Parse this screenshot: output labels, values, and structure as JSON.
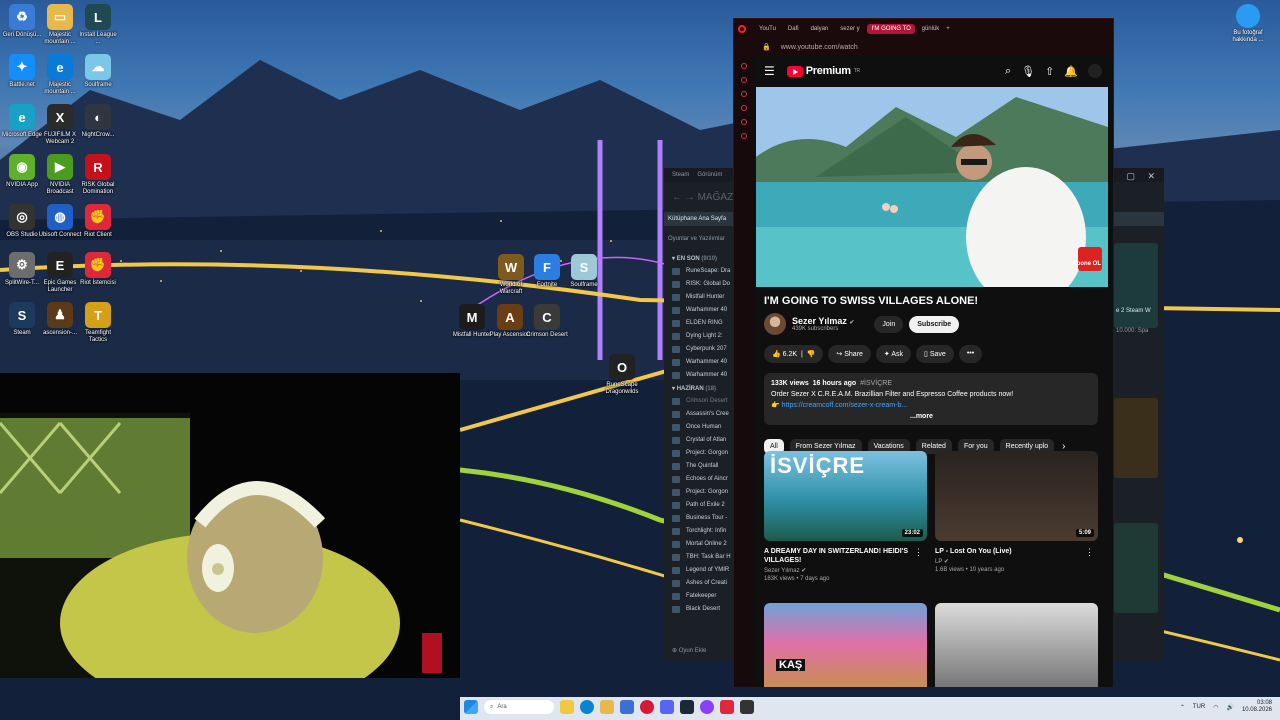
{
  "desktop": {
    "icons": [
      {
        "label": "Geri Dönüşü...",
        "color": "#3a7bd5",
        "glyph": "♻"
      },
      {
        "label": "Majestic mountain ...",
        "color": "#e8b84a",
        "glyph": "▭"
      },
      {
        "label": "Install League ...",
        "color": "#1f4a52",
        "glyph": "L"
      },
      {
        "label": "Battle.net",
        "color": "#148eff",
        "glyph": "✦"
      },
      {
        "label": "Majestic mountain ...",
        "color": "#0a7ad9",
        "glyph": "e"
      },
      {
        "label": "Soulframe",
        "color": "#7bc7e8",
        "glyph": "☁"
      },
      {
        "label": "Microsoft Edge",
        "color": "#19a0c7",
        "glyph": "e"
      },
      {
        "label": "FUJIFILM X Webcam 2",
        "color": "#2b2b2b",
        "glyph": "X"
      },
      {
        "label": "NightCrow...",
        "color": "#2f3640",
        "glyph": "◐"
      },
      {
        "label": "NVIDIA App",
        "color": "#5fb12b",
        "glyph": "◉"
      },
      {
        "label": "NVIDIA Broadcast",
        "color": "#4c9c1f",
        "glyph": "▶"
      },
      {
        "label": "RISK Global Domination",
        "color": "#c4121a",
        "glyph": "R"
      },
      {
        "label": "OBS Studio",
        "color": "#333",
        "glyph": "◎"
      },
      {
        "label": "Ubisoft Connect",
        "color": "#1f5fc7",
        "glyph": "◍"
      },
      {
        "label": "Riot Client",
        "color": "#e0283b",
        "glyph": "✊"
      },
      {
        "label": "SplitWire-T...",
        "color": "#6d6d6d",
        "glyph": "⚙"
      },
      {
        "label": "Epic Games Launcher",
        "color": "#222",
        "glyph": "E"
      },
      {
        "label": "Riot İstemcisi",
        "color": "#e0283b",
        "glyph": "✊"
      },
      {
        "label": "Steam",
        "color": "#1b3a5c",
        "glyph": "S"
      },
      {
        "label": "ascension-...",
        "color": "#5b3a1a",
        "glyph": "♟"
      },
      {
        "label": "Teamfight Tactics",
        "color": "#d4a017",
        "glyph": "T"
      },
      {
        "label": "World of Warcraft",
        "color": "#7d5a1e",
        "glyph": "W"
      },
      {
        "label": "Fortnite",
        "color": "#2a7de1",
        "glyph": "F"
      },
      {
        "label": "Soulframe",
        "color": "#9ec7d8",
        "glyph": "S"
      },
      {
        "label": "Mistfall Hunter",
        "color": "#1c1c1c",
        "glyph": "M"
      },
      {
        "label": "Play Ascension",
        "color": "#6b3d15",
        "glyph": "A"
      },
      {
        "label": "Crimson Desert",
        "color": "#3a3a3a",
        "glyph": "C"
      },
      {
        "label": "RuneScape Dragonwilds",
        "color": "#222",
        "glyph": "O"
      }
    ],
    "notify": {
      "label": "Bu fotoğraf hakkında ..."
    }
  },
  "steam": {
    "title_items": [
      "Steam",
      "Görünüm"
    ],
    "store_label": "MAĞAZA",
    "library_home": "Kütüphane Ana Sayfa",
    "filter": "Oyunlar ve Yazılımlar",
    "section_recent": "EN SON",
    "section_recent_count": "(9/10)",
    "recent": [
      "RuneScape: Dra",
      "RISK: Global Do",
      "Mistfall Hunter",
      "Warhammer 40",
      "ELDEN RING",
      "Dying Light 2:",
      "Cyberpunk 207",
      "Warhammer 40",
      "Warhammer 40"
    ],
    "section_june": "HAZİRAN",
    "section_june_count": "(18)",
    "june": [
      "Crimson Desert",
      "Assassin's Cree",
      "Once Human",
      "Crystal of Atlan",
      "Project: Gorgon",
      "The Quinfall",
      "Echoes of Aincr",
      "Project: Gorgon",
      "Path of Exile 2",
      "Business Tour -",
      "Torchlight: Infin",
      "Mortal Online 2",
      "TBH: Task Bar H",
      "Legend of YMIR",
      "Ashes of Creati",
      "Fatekeeper",
      "Black Desert"
    ],
    "add_game": "Oyun Ekle",
    "shelf_labels": [
      "e 2 Steam W",
      "10.000: Spa"
    ]
  },
  "browser": {
    "tabs": [
      {
        "label": "YouTu",
        "active": false
      },
      {
        "label": "Dafi",
        "active": false
      },
      {
        "label": "dalyan",
        "active": false
      },
      {
        "label": "sezer y",
        "active": false
      },
      {
        "label": "I'M GOING TO",
        "active": true
      },
      {
        "label": "günlük",
        "active": false
      }
    ],
    "url": "www.youtube.com/watch"
  },
  "youtube": {
    "logo_text": "Premium",
    "region": "TR",
    "video": {
      "title": "I'M GOING TO SWISS VILLAGES ALONE!",
      "watermark": "Abone OL"
    },
    "channel": {
      "name": "Sezer Yılmaz",
      "subs": "439K subscribers",
      "join": "Join",
      "subscribe": "Subscribe"
    },
    "actions": {
      "likes": "6.2K",
      "share": "Share",
      "ask": "Ask",
      "save": "Save"
    },
    "description": {
      "views": "133K views",
      "age": "16 hours ago",
      "tag": "#İSVİÇRE",
      "line1": "Order Sezer X C.R.E.A.M. Brazillian Filter and Espresso Coffee products now!",
      "link": "https://creamcoff.com/sezer-x-cream-b...",
      "more": "...more"
    },
    "chips": [
      "All",
      "From Sezer Yılmaz",
      "Vacations",
      "Related",
      "For you",
      "Recently uplo"
    ],
    "recommendations": [
      {
        "title": "A DREAMY DAY IN SWITZERLAND! HEIDI'S VILLAGES!",
        "channel": "Sezer Yılmaz",
        "meta": "183K views • 7 days ago",
        "duration": "23:02",
        "overlay": "İSVİÇRE"
      },
      {
        "title": "LP - Lost On You (Live)",
        "channel": "LP",
        "meta": "1.6B views • 10 years ago",
        "duration": "5:09",
        "overlay": ""
      },
      {
        "title": "",
        "channel": "",
        "meta": "",
        "duration": "",
        "overlay": "KAŞ"
      },
      {
        "title": "",
        "channel": "",
        "meta": "",
        "duration": "",
        "overlay": ""
      }
    ]
  },
  "taskbar": {
    "search": "Ara",
    "lang": "TUR",
    "time": "03:08",
    "date": "10.08.2026"
  },
  "colors": {
    "yt_red": "#ff0033",
    "opera_red": "#b3143a",
    "link": "#3ea6ff"
  }
}
